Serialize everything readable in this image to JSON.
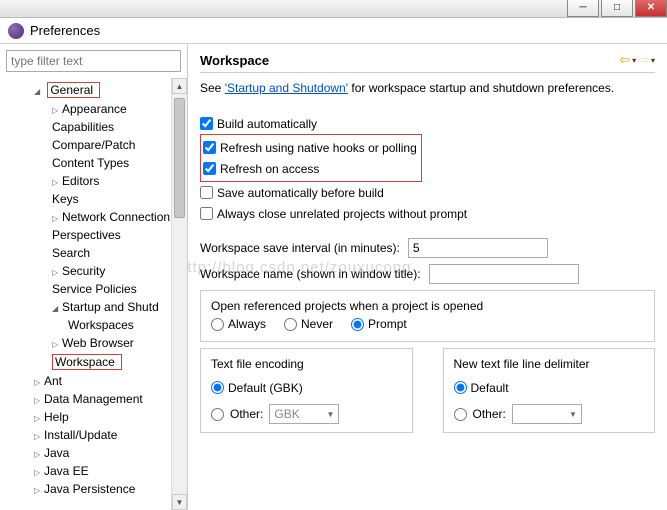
{
  "window": {
    "title": "Preferences"
  },
  "filter_placeholder": "type filter text",
  "tree": {
    "general": "General",
    "items1": [
      "Appearance",
      "Capabilities",
      "Compare/Patch",
      "Content Types",
      "Editors",
      "Keys",
      "Network Connections",
      "Perspectives",
      "Search",
      "Security",
      "Service Policies",
      "Startup and Shutdown"
    ],
    "workspaces": "Workspaces",
    "webbrowser": "Web Browser",
    "workspace": "Workspace",
    "post": [
      "Ant",
      "Data Management",
      "Help",
      "Install/Update",
      "Java",
      "Java EE",
      "Java Persistence"
    ]
  },
  "main": {
    "title": "Workspace",
    "desc_pre": "See ",
    "desc_link": "'Startup and Shutdown'",
    "desc_post": " for workspace startup and shutdown preferences.",
    "cb": {
      "build": "Build automatically",
      "refresh_hooks": "Refresh using native hooks or polling",
      "refresh_access": "Refresh on access",
      "save_before": "Save automatically before build",
      "close_unrelated": "Always close unrelated projects without prompt"
    },
    "save_interval_lbl": "Workspace save interval (in minutes):",
    "save_interval_val": "5",
    "ws_name_lbl": "Workspace name (shown in window title):",
    "ws_name_val": "",
    "open_ref_lbl": "Open referenced projects when a project is opened",
    "open_ref": {
      "always": "Always",
      "never": "Never",
      "prompt": "Prompt"
    },
    "encoding": {
      "title": "Text file encoding",
      "default": "Default (GBK)",
      "other": "Other:",
      "combo": "GBK"
    },
    "delimiter": {
      "title": "New text file line delimiter",
      "default": "Default",
      "other": "Other:",
      "combo": ""
    }
  }
}
